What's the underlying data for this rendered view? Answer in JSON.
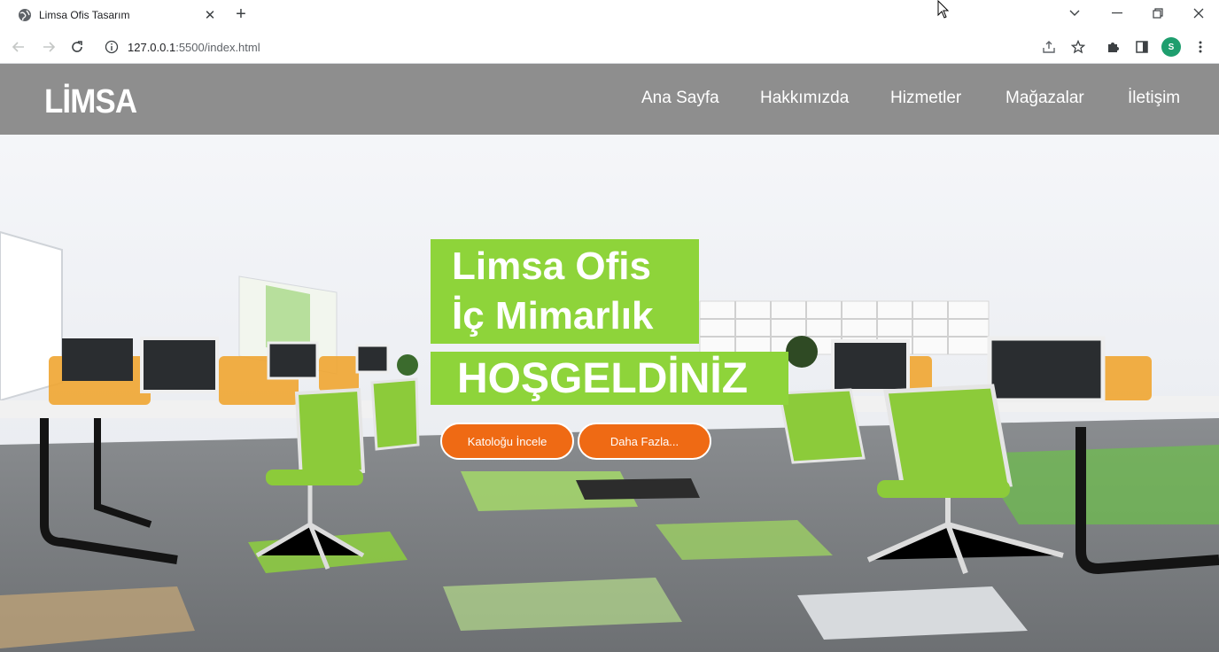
{
  "browser": {
    "tab_title": "Limsa Ofis Tasarım",
    "url_host": "127.0.0.1",
    "url_rest": ":5500/index.html",
    "profile_initial": "S"
  },
  "site": {
    "logo": "LİMSA",
    "nav": [
      "Ana Sayfa",
      "Hakkımızda",
      "Hizmetler",
      "Mağazalar",
      "İletişim"
    ],
    "hero_line1": "Limsa Ofis",
    "hero_line2": "İç Mimarlık",
    "welcome": "HOŞGELDİNİZ",
    "btn_catalog": "Katoloğu İncele",
    "btn_more": "Daha Fazla..."
  },
  "colors": {
    "header_bg": "#8e8e8e",
    "accent_green": "#8ed43a",
    "button_orange": "#ef6a14"
  }
}
